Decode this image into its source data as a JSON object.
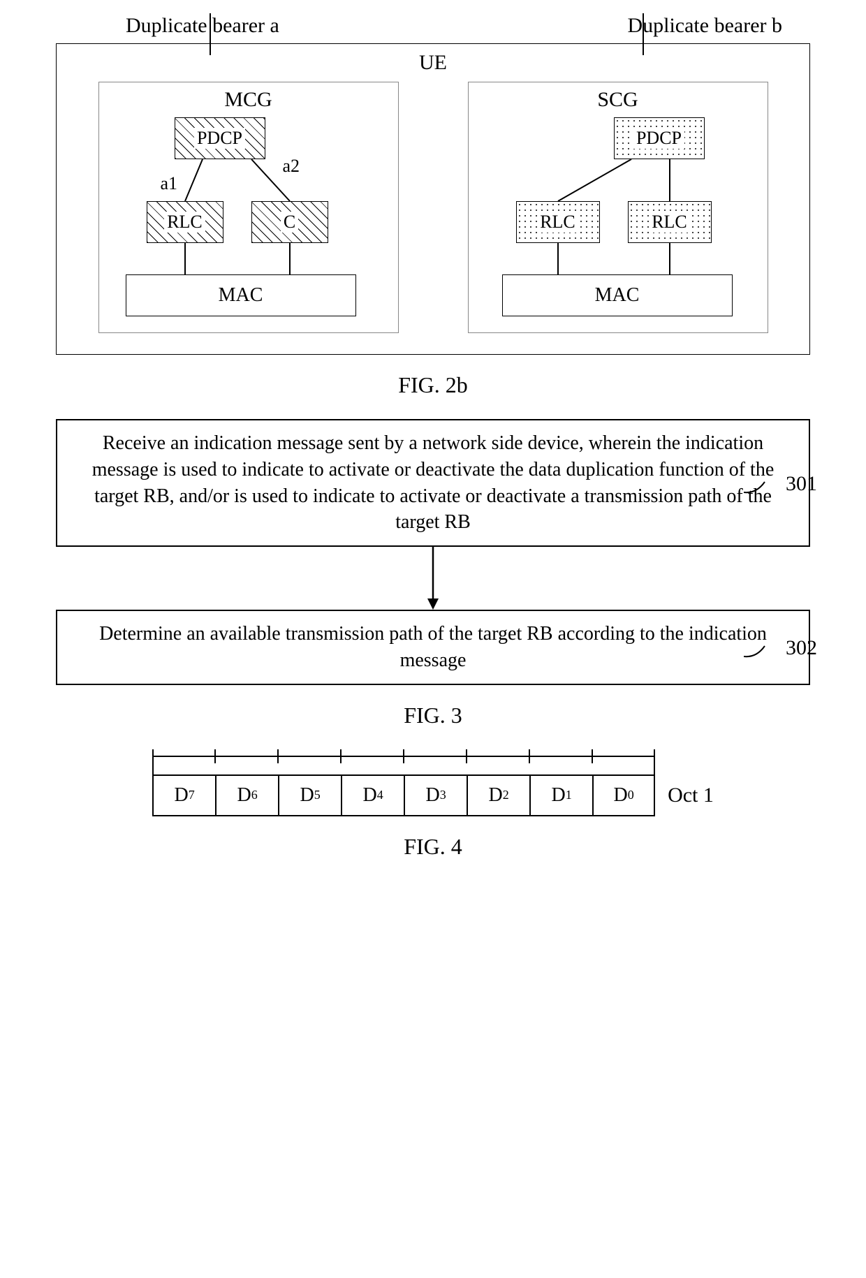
{
  "top": {
    "bearer_a": "Duplicate bearer a",
    "bearer_b": "Duplicate bearer b",
    "ue": "UE"
  },
  "mcg": {
    "title": "MCG",
    "pdcp": "PDCP",
    "rlc1": "RLC",
    "rlc2": "C",
    "mac": "MAC",
    "a1": "a1",
    "a2": "a2"
  },
  "scg": {
    "title": "SCG",
    "pdcp": "PDCP",
    "rlc1": "RLC",
    "rlc2": "RLC",
    "mac": "MAC"
  },
  "fig2b": "FIG. 2b",
  "flow": {
    "step1": "Receive an indication message sent by a network side device, wherein the indication message is used to indicate to activate or deactivate the data duplication function of the target RB, and/or is used to indicate to activate or deactivate a transmission path of the target RB",
    "num1": "301",
    "step2": "Determine an available transmission path of the target RB according to the indication message",
    "num2": "302"
  },
  "fig3": "FIG. 3",
  "bytes": {
    "cells": [
      "D₇",
      "D₆",
      "D₅",
      "D₄",
      "D₃",
      "D₂",
      "D₁",
      "D₀"
    ],
    "oct": "Oct 1"
  },
  "fig4": "FIG. 4"
}
